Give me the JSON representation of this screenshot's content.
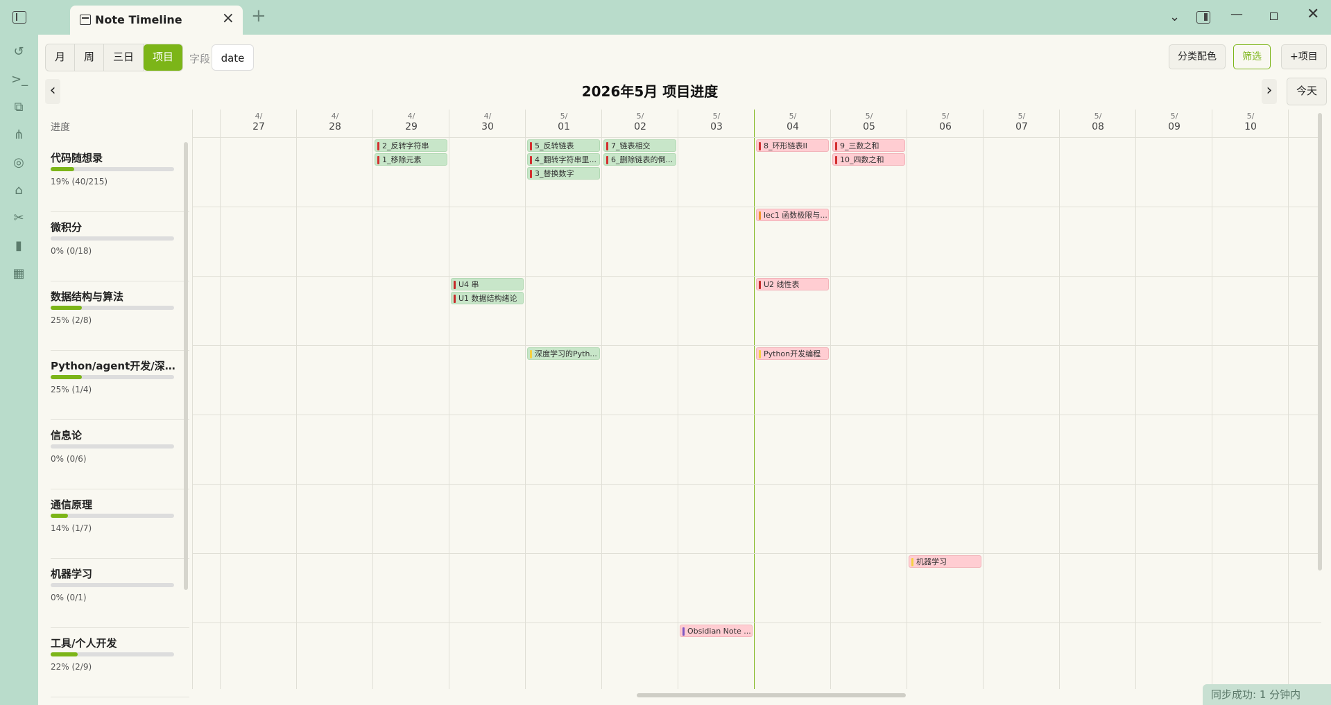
{
  "window": {
    "tab_title": "Note Timeline",
    "new_tab": "+"
  },
  "toolbar": {
    "views": [
      "月",
      "周",
      "三日",
      "项目"
    ],
    "active_view": "项目",
    "field_label": "字段",
    "field_value": "date",
    "color_by_category": "分类配色",
    "filter": "筛选",
    "add_project": "+项目",
    "prev": "‹",
    "next": "›",
    "today": "今天"
  },
  "heading": "2026年5月 项目进度",
  "progress_header": "进度",
  "projects": [
    {
      "name": "代码随想录",
      "progress_text": "19% (40/215)",
      "percent": 19
    },
    {
      "name": "微积分",
      "progress_text": "0% (0/18)",
      "percent": 0
    },
    {
      "name": "数据结构与算法",
      "progress_text": "25% (2/8)",
      "percent": 25
    },
    {
      "name": "Python/agent开发/深度...",
      "progress_text": "25% (1/4)",
      "percent": 25
    },
    {
      "name": "信息论",
      "progress_text": "0% (0/6)",
      "percent": 0
    },
    {
      "name": "通信原理",
      "progress_text": "14% (1/7)",
      "percent": 14
    },
    {
      "name": "机器学习",
      "progress_text": "0% (0/1)",
      "percent": 0
    },
    {
      "name": "工具/个人开发",
      "progress_text": "22% (2/9)",
      "percent": 22
    }
  ],
  "dates": [
    {
      "month": "4/",
      "day": "27"
    },
    {
      "month": "4/",
      "day": "28"
    },
    {
      "month": "4/",
      "day": "29"
    },
    {
      "month": "4/",
      "day": "30"
    },
    {
      "month": "5/",
      "day": "01"
    },
    {
      "month": "5/",
      "day": "02"
    },
    {
      "month": "5/",
      "day": "03"
    },
    {
      "month": "5/",
      "day": "04"
    },
    {
      "month": "5/",
      "day": "05"
    },
    {
      "month": "5/",
      "day": "06"
    },
    {
      "month": "5/",
      "day": "07"
    },
    {
      "month": "5/",
      "day": "08"
    },
    {
      "month": "5/",
      "day": "09"
    },
    {
      "month": "5/",
      "day": "10"
    }
  ],
  "today_index": 7,
  "events": [
    {
      "project": 0,
      "date": 2,
      "slot": 0,
      "label": "2_反转字符串",
      "style": "green",
      "bar": "#d32f2f"
    },
    {
      "project": 0,
      "date": 2,
      "slot": 1,
      "label": "1_移除元素",
      "style": "green",
      "bar": "#d32f2f"
    },
    {
      "project": 0,
      "date": 4,
      "slot": 0,
      "label": "5_反转链表",
      "style": "green",
      "bar": "#d32f2f"
    },
    {
      "project": 0,
      "date": 4,
      "slot": 1,
      "label": "4_翻转字符串里...",
      "style": "green",
      "bar": "#d32f2f"
    },
    {
      "project": 0,
      "date": 4,
      "slot": 2,
      "label": "3_替换数字",
      "style": "green",
      "bar": "#d32f2f"
    },
    {
      "project": 0,
      "date": 5,
      "slot": 0,
      "label": "7_链表相交",
      "style": "green",
      "bar": "#d32f2f"
    },
    {
      "project": 0,
      "date": 5,
      "slot": 1,
      "label": "6_删除链表的倒...",
      "style": "green",
      "bar": "#d32f2f"
    },
    {
      "project": 0,
      "date": 7,
      "slot": 0,
      "label": "8_环形链表II",
      "style": "red",
      "bar": "#d32f2f"
    },
    {
      "project": 0,
      "date": 8,
      "slot": 0,
      "label": "9_三数之和",
      "style": "red",
      "bar": "#d32f2f"
    },
    {
      "project": 0,
      "date": 8,
      "slot": 1,
      "label": "10_四数之和",
      "style": "red",
      "bar": "#d32f2f"
    },
    {
      "project": 1,
      "date": 7,
      "slot": 0,
      "label": "lec1 函数极限与...",
      "style": "red",
      "bar": "#f0932b"
    },
    {
      "project": 2,
      "date": 3,
      "slot": 0,
      "label": "U4 串",
      "style": "green",
      "bar": "#c62828"
    },
    {
      "project": 2,
      "date": 3,
      "slot": 1,
      "label": "U1 数据结构绪论",
      "style": "green",
      "bar": "#c62828"
    },
    {
      "project": 2,
      "date": 7,
      "slot": 0,
      "label": "U2 线性表",
      "style": "red",
      "bar": "#c62828"
    },
    {
      "project": 3,
      "date": 4,
      "slot": 0,
      "label": "深度学习的Pyth...",
      "style": "green",
      "bar": "#f5d142"
    },
    {
      "project": 3,
      "date": 7,
      "slot": 0,
      "label": "Python开发编程",
      "style": "red",
      "bar": "#f5d142"
    },
    {
      "project": 6,
      "date": 9,
      "slot": 0,
      "label": "机器学习",
      "style": "red",
      "bar": "#f5d142"
    },
    {
      "project": 7,
      "date": 6,
      "slot": 0,
      "label": "Obsidian Note ...",
      "style": "red",
      "bar": "#7e57c2"
    }
  ],
  "status_bar": "同步成功: 1 分钟内"
}
